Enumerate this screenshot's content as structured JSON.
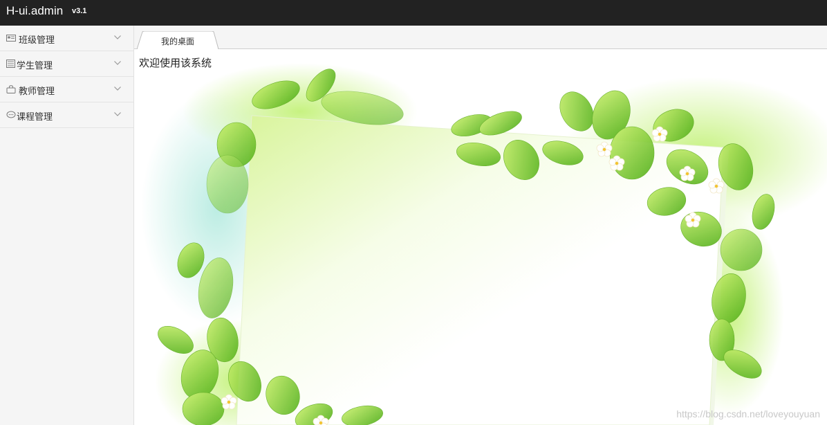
{
  "header": {
    "logo": "H-ui.admin",
    "version": "v3.1"
  },
  "sidebar": {
    "items": [
      {
        "label": "班级管理",
        "icon": "class-card-icon"
      },
      {
        "label": "学生管理",
        "icon": "student-list-icon"
      },
      {
        "label": "教师管理",
        "icon": "teacher-bag-icon"
      },
      {
        "label": "课程管理",
        "icon": "course-chat-icon"
      }
    ]
  },
  "tabs": [
    {
      "label": "我的桌面"
    }
  ],
  "content": {
    "welcome": "欢迎使用该系统"
  },
  "watermark": "https://blog.csdn.net/loveyouyuan",
  "colors": {
    "topbar": "#222222",
    "sidebar_bg": "#f5f5f5",
    "leaf_green": "#7ac51f"
  }
}
